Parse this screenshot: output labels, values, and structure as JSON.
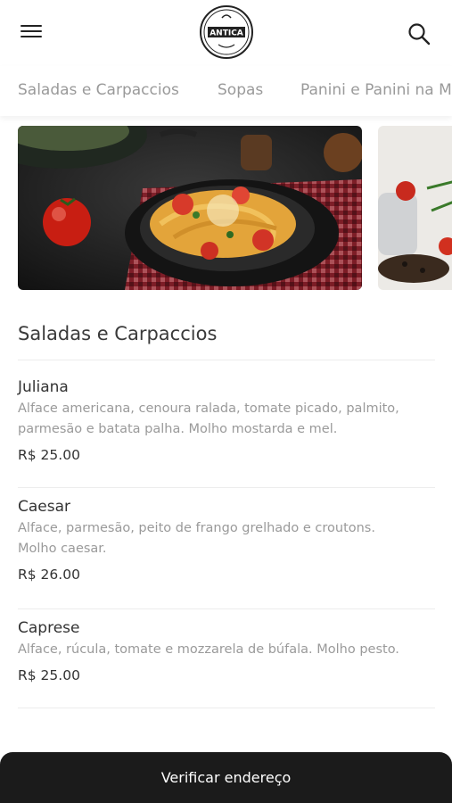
{
  "header": {
    "logo_text": "ANTICA",
    "menu_icon": "hamburger-menu-icon",
    "search_icon": "search-icon"
  },
  "categories": [
    "Saladas e Carpaccios",
    "Sopas",
    "Panini e Panini na M"
  ],
  "banners": [
    "pasta-dish-image",
    "spices-image"
  ],
  "section": {
    "title": "Saladas e Carpaccios"
  },
  "items": [
    {
      "name": "Juliana",
      "desc_line1": "Alface americana, cenoura ralada, tomate picado, palmito,",
      "desc_line2": "parmesão e batata palha. Molho mostarda e mel.",
      "price": "R$ 25.00"
    },
    {
      "name": "Caesar",
      "desc_line1": "Alface, parmesão, peito de frango grelhado e croutons.",
      "desc_line2": "Molho caesar.",
      "price": "R$ 26.00"
    },
    {
      "name": "Caprese",
      "desc_line1": "Alface, rúcula, tomate e mozzarela de búfala. Molho pesto.",
      "desc_line2": "",
      "price": "R$ 25.00"
    }
  ],
  "bottom": {
    "button_label": "Verificar endereço"
  },
  "colors": {
    "bottom_bar": "#1b1b1b",
    "muted_text": "#9a9a9a"
  }
}
